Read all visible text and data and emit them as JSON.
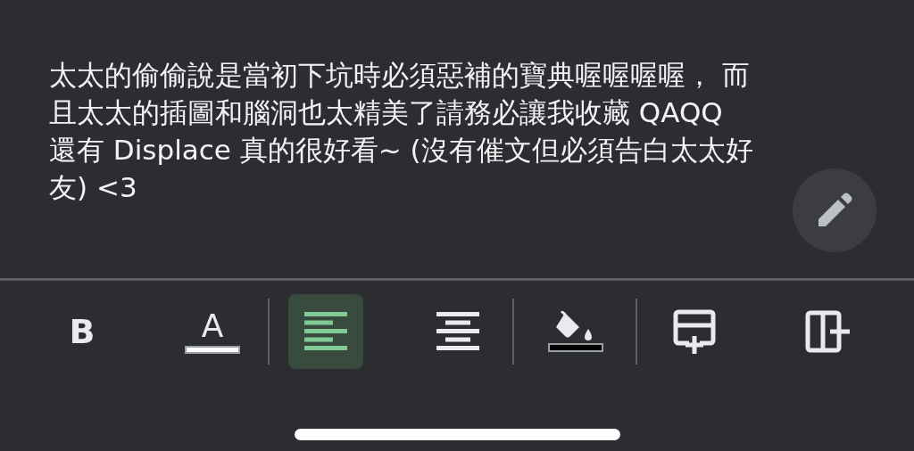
{
  "comment": {
    "text": "太太的偷偷說是當初下坑時必須惡補的寶典喔喔喔喔， 而且太太的插圖和腦洞也太精美了請務必讓我收藏 QAQQ 還有 Displace 真的很好看~ (沒有催文但必須告白太太好友) <3"
  },
  "toolbar": [
    {
      "kind": "bold",
      "label": "B",
      "selected": false
    },
    {
      "kind": "text-color",
      "label": "A",
      "selected": false,
      "color": "#ffffff"
    },
    {
      "kind": "divider"
    },
    {
      "kind": "align-left",
      "selected": true
    },
    {
      "kind": "align-center",
      "selected": false
    },
    {
      "kind": "divider"
    },
    {
      "kind": "fill-color",
      "selected": false,
      "color": "#000000"
    },
    {
      "kind": "divider"
    },
    {
      "kind": "insert-row",
      "selected": false
    },
    {
      "kind": "insert-column",
      "selected": false
    }
  ]
}
